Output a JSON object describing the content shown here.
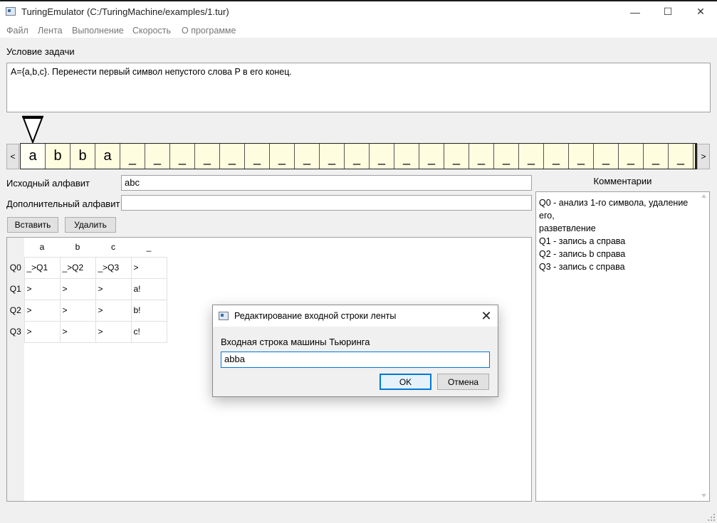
{
  "window": {
    "title": "TuringEmulator (C:/TuringMachine/examples/1.tur)",
    "minimize_glyph": "—",
    "maximize_glyph": "☐",
    "close_glyph": "✕"
  },
  "menu": [
    "Файл",
    "Лента",
    "Выполнение",
    "Скорость",
    "О программе"
  ],
  "condition": {
    "label": "Условие задачи",
    "text": "A={a,b,c}. Перенести первый символ непустого слова P в его конец."
  },
  "tape": {
    "left_arrow": "<",
    "right_arrow": ">",
    "cells": [
      "a",
      "b",
      "b",
      "a",
      "_",
      "_",
      "_",
      "_",
      "_",
      "_",
      "_",
      "_",
      "_",
      "_",
      "_",
      "_",
      "_",
      "_",
      "_",
      "_",
      "_",
      "_",
      "_",
      "_",
      "_",
      "_",
      "_"
    ]
  },
  "alphabet": {
    "source_label": "Исходный алфавит",
    "source_value": "abc",
    "extra_label": "Дополнительный алфавит",
    "extra_value": ""
  },
  "buttons": {
    "insert": "Вставить",
    "delete": "Удалить"
  },
  "rules_table": {
    "columns": [
      "a",
      "b",
      "c",
      "_"
    ],
    "rows": [
      {
        "state": "Q0",
        "cells": [
          "_>Q1",
          "_>Q2",
          "_>Q3",
          ">"
        ]
      },
      {
        "state": "Q1",
        "cells": [
          ">",
          ">",
          ">",
          "a!"
        ]
      },
      {
        "state": "Q2",
        "cells": [
          ">",
          ">",
          ">",
          "b!"
        ]
      },
      {
        "state": "Q3",
        "cells": [
          ">",
          ">",
          ">",
          "c!"
        ]
      }
    ]
  },
  "comments": {
    "label": "Комментарии",
    "lines": [
      "Q0 - анализ 1-го символа, удаление его,",
      "разветвление",
      "Q1 - запись a справа",
      "Q2 - запись b справа",
      "Q3 - запись c справа"
    ]
  },
  "dialog": {
    "title": "Редактирование входной строки ленты",
    "label": "Входная строка машины Тьюринга",
    "value": "abba",
    "ok": "OK",
    "cancel": "Отмена",
    "close_glyph": "✕"
  }
}
